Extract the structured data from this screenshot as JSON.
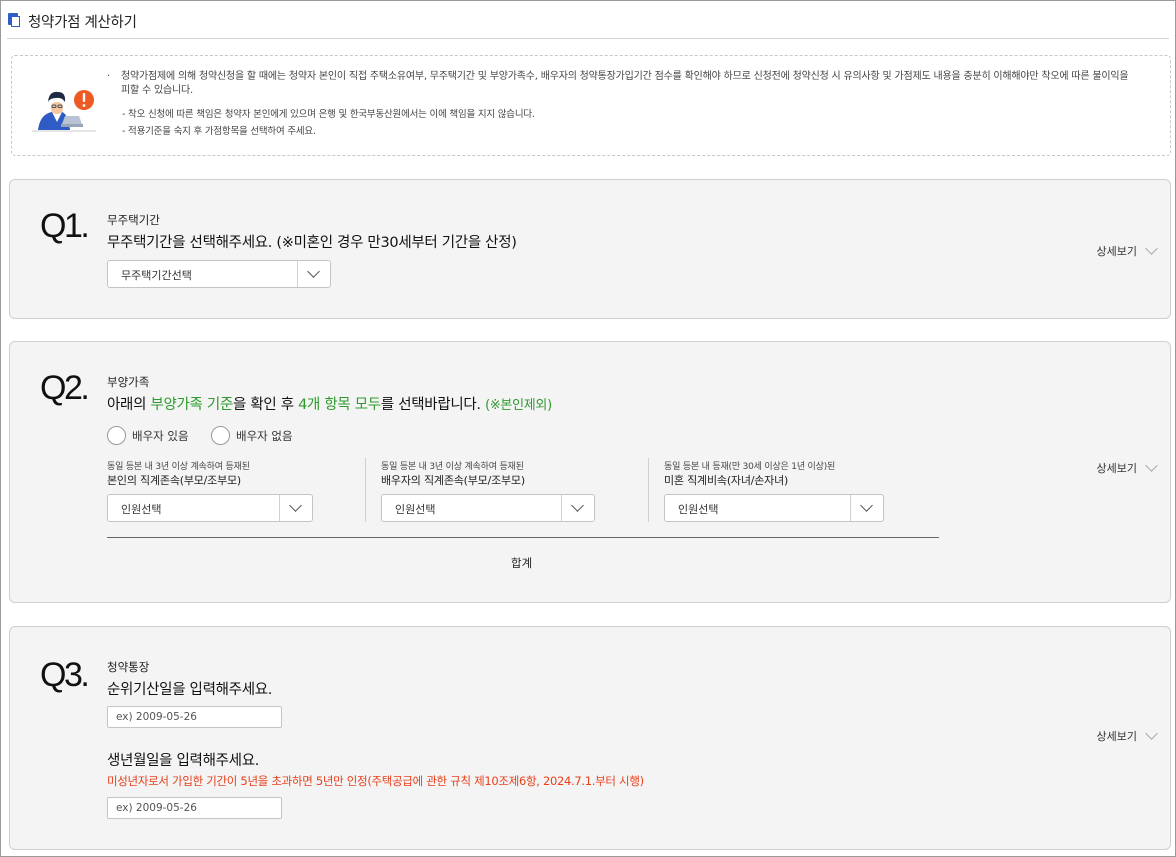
{
  "header": {
    "title": "청약가점 계산하기"
  },
  "notice": {
    "bullet": "·",
    "main_text": "청약가점제에 의해 청약신청을 할 때에는 청약자 본인이 직접 주택소유여부, 무주택기간 및 부양가족수, 배우자의 청약통장가입기간 점수를 확인해야 하므로 신청전에 청약신청 시 유의사항 및 가점제도 내용을 충분히 이해해야만 착오에 따른 불이익을 피할 수 있습니다.",
    "sub_items": [
      "- 착오 신청에 따른 책임은 청약자 본인에게 있으며 은행 및 한국부동산원에서는 이에 책임을 지지 않습니다.",
      "- 적용기준을 숙지 후 가점항목을 선택하여 주세요."
    ]
  },
  "q1": {
    "number": "Q1.",
    "category": "무주택기간",
    "question": "무주택기간을 선택해주세요. (※미혼인 경우 만30세부터 기간을 산정)",
    "select_value": "무주택기간선택",
    "detail_label": "상세보기"
  },
  "q2": {
    "number": "Q2.",
    "category": "부양가족",
    "question_parts": [
      "아래의 ",
      "부양가족 기준",
      "을 확인 후 ",
      "4개 항목 모두",
      "를 선택바랍니다. ",
      "(※본인제외)"
    ],
    "radio_yes": "배우자 있음",
    "radio_no": "배우자 없음",
    "columns": [
      {
        "sub": "동일 등본 내 3년 이상 계속하여 등재된",
        "main": "본인의 직계존속(부모/조부모)",
        "select_value": "인원선택"
      },
      {
        "sub": "동일 등본 내 3년 이상 계속하여 등재된",
        "main": "배우자의 직계존속(부모/조부모)",
        "select_value": "인원선택"
      },
      {
        "sub": "동일 등본 내 등재(만 30세 이상은 1년 이상)된",
        "main": "미혼 직계비속(자녀/손자녀)",
        "select_value": "인원선택"
      }
    ],
    "total_label": "합계",
    "detail_label": "상세보기"
  },
  "q3": {
    "number": "Q3.",
    "category": "청약통장",
    "question1": "순위기산일을 입력해주세요.",
    "input1_placeholder": "ex) 2009-05-26",
    "question2": "생년월일을 입력해주세요.",
    "warning": "미성년자로서 가입한 기간이 5년을 초과하면 5년만 인정(주택공급에 관한 규칙 제10조제6항, 2024.7.1.부터 시행)",
    "input2_placeholder": "ex) 2009-05-26",
    "detail_label": "상세보기"
  },
  "colors": {
    "accent_green": "#2e9a2e",
    "warning_red": "#e8401c",
    "title_icon_blue": "#2d5fc7"
  }
}
